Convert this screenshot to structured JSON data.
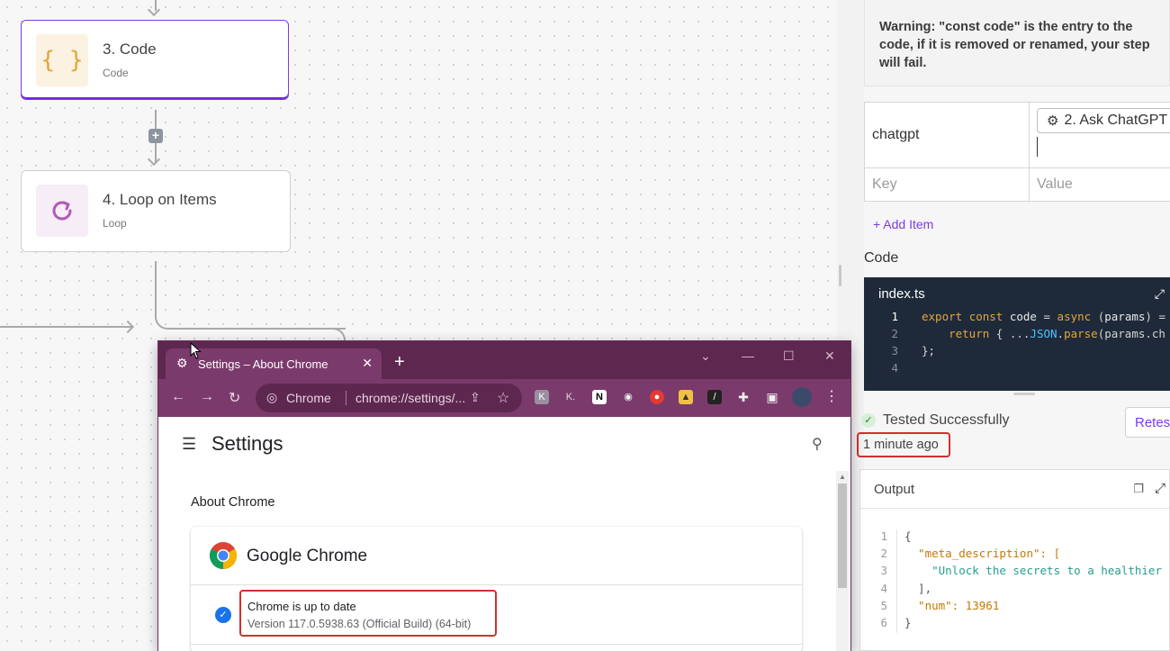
{
  "flow": {
    "nodes": [
      {
        "title": "3. Code",
        "subtitle": "Code",
        "icon": "code-braces-icon"
      },
      {
        "title": "4. Loop on Items",
        "subtitle": "Loop",
        "icon": "loop-icon"
      }
    ],
    "add_step_symbol": "+"
  },
  "panel": {
    "warning": "Warning: \"const code\" is the entry to the code, if it is removed or renamed, your step will fail.",
    "inputs": {
      "row1_key": "chatgpt",
      "row1_value_chip": "2. Ask ChatGPT",
      "key_placeholder": "Key",
      "value_placeholder": "Value"
    },
    "add_item": "+ Add Item",
    "code_label": "Code",
    "editor": {
      "filename": "index.ts",
      "lines": [
        {
          "n": "1",
          "text": "export const code = async (params) ="
        },
        {
          "n": "2",
          "text": "    return { ...JSON.parse(params.ch"
        },
        {
          "n": "3",
          "text": "};"
        },
        {
          "n": "4",
          "text": ""
        }
      ]
    },
    "status": "Tested Successfully",
    "retest": "Retes",
    "time_ago": "1 minute ago",
    "output": {
      "title": "Output",
      "lines": [
        {
          "n": "1",
          "text": "{"
        },
        {
          "n": "2",
          "text": "  \"meta_description\": ["
        },
        {
          "n": "3",
          "text": "    \"Unlock the secrets to a healthier"
        },
        {
          "n": "4",
          "text": "  ],"
        },
        {
          "n": "5",
          "text": "  \"num\": 13961"
        },
        {
          "n": "6",
          "text": "}"
        }
      ]
    }
  },
  "chrome": {
    "tab_title": "Settings – About Chrome",
    "omnibox_site": "Chrome",
    "omnibox_url": "chrome://settings/...",
    "page_title": "Settings",
    "section": "About Chrome",
    "product": "Google Chrome",
    "status_line1": "Chrome is up to date",
    "status_line2": "Version 117.0.5938.63 (Official Build) (64-bit)",
    "colors": {
      "frame": "#5e2750",
      "toolbar": "#7b3a6c"
    }
  },
  "colors": {
    "accent": "#7c3aed",
    "highlight": "#d32f2f",
    "editor_bg": "#1e2a3a"
  }
}
